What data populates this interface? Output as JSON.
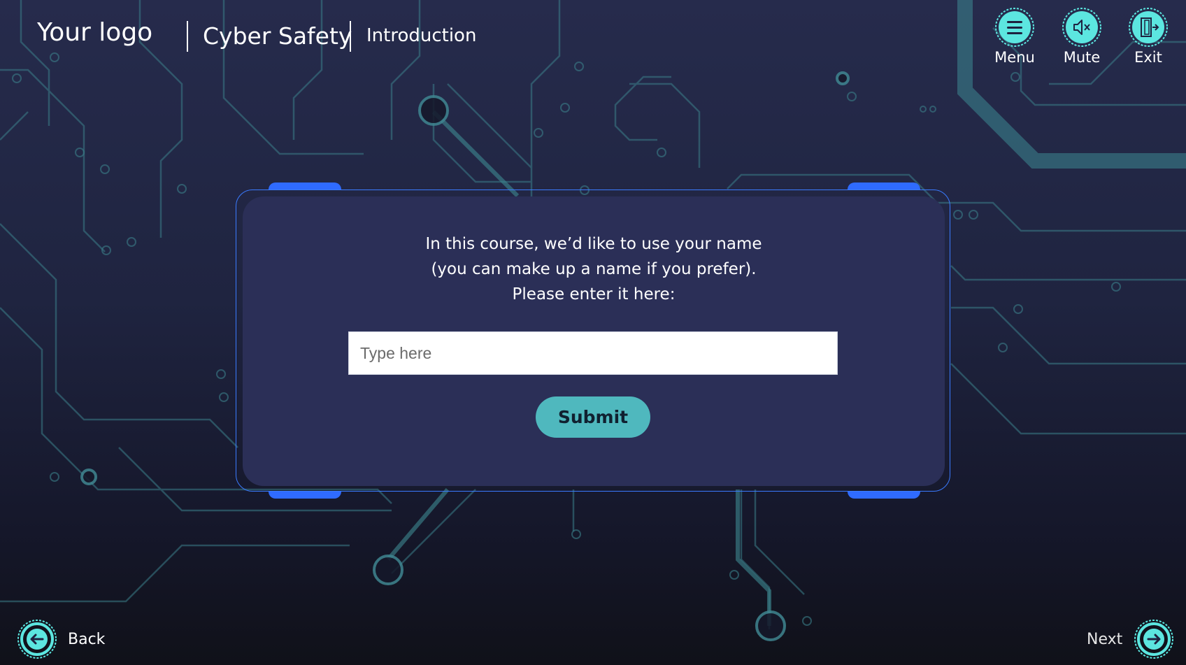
{
  "header": {
    "logo": "Your logo",
    "course_title": "Cyber Safety",
    "section_title": "Introduction"
  },
  "top_buttons": {
    "menu": {
      "label": "Menu",
      "icon": "hamburger-menu-icon"
    },
    "mute": {
      "label": "Mute",
      "icon": "speaker-mute-icon"
    },
    "exit": {
      "label": "Exit",
      "icon": "exit-door-icon"
    }
  },
  "dialog": {
    "prompt_lines": [
      "In this course, we’d like to use your name",
      "(you can make up a name if you prefer).",
      "Please enter it here:"
    ],
    "input": {
      "placeholder": "Type here",
      "value": ""
    },
    "submit_label": "Submit"
  },
  "nav": {
    "back_label": "Back",
    "next_label": "Next"
  },
  "colors": {
    "accent": "#4fb8be",
    "icon_fill": "#5ce6e0",
    "panel": "#2b2f57",
    "frame": "#3a7bff",
    "circuit": "#3d7f8a"
  }
}
